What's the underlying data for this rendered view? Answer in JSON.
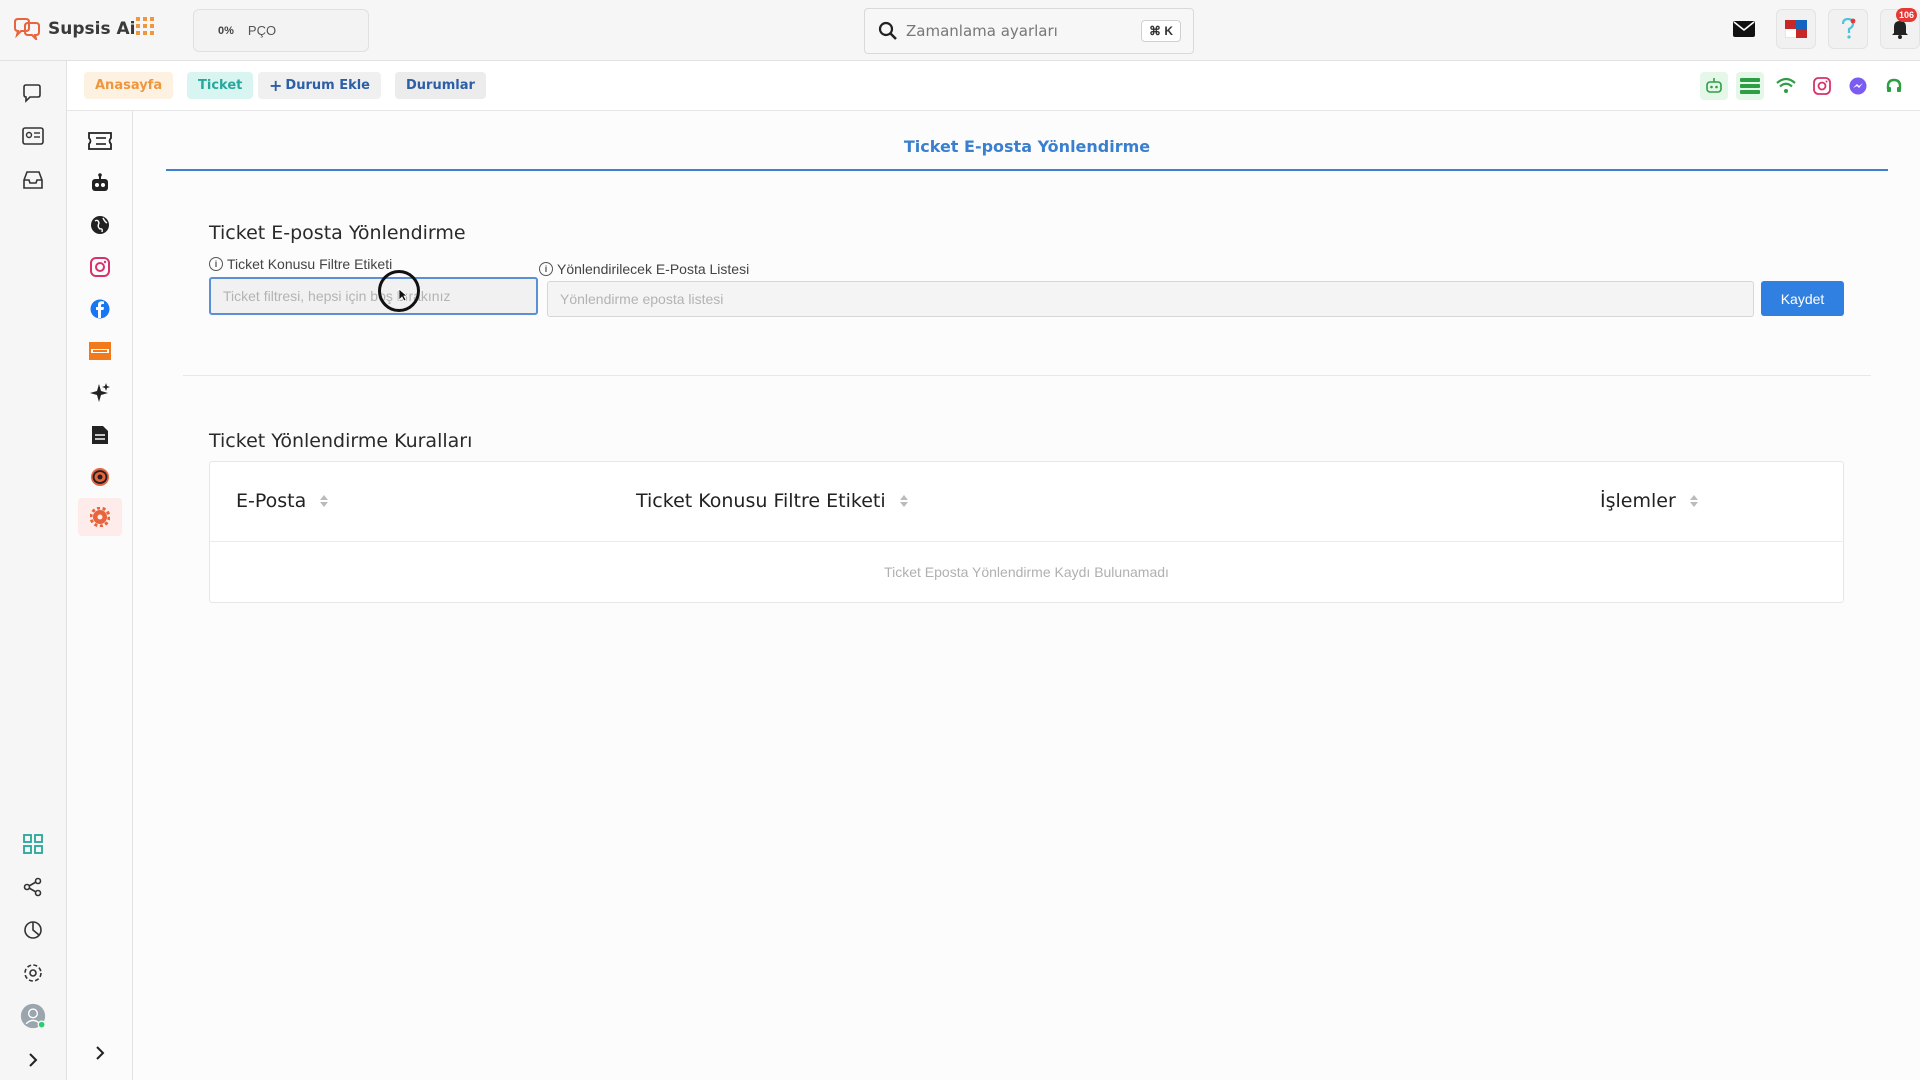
{
  "app": {
    "name": "Supsis Ai",
    "progress": {
      "percent": "0%",
      "label": "PÇO"
    },
    "search_placeholder": "Zamanlama ayarları",
    "search_shortcut": "⌘ K",
    "notification_count": "106"
  },
  "breadcrumbs": {
    "home": "Anasayfa",
    "ticket": "Ticket",
    "add_status": "Durum Ekle",
    "statuses": "Durumlar"
  },
  "page": {
    "tab_title": "Ticket E-posta Yönlendirme",
    "form_title": "Ticket E-posta Yönlendirme",
    "filter_label": "Ticket Konusu Filtre Etiketi",
    "filter_placeholder": "Ticket filtresi, hepsi için boş bırakınız",
    "email_label": "Yönlendirilecek E-Posta Listesi",
    "email_placeholder": "Yönlendirme eposta listesi",
    "save_label": "Kaydet",
    "rules_title": "Ticket Yönlendirme Kuralları",
    "columns": [
      "E-Posta",
      "Ticket Konusu Filtre Etiketi",
      "İşlemler"
    ],
    "empty_text": "Ticket Eposta Yönlendirme Kaydı Bulunamadı"
  },
  "colors": {
    "accent": "#2f80e0",
    "home_chip": "#f0963c",
    "ticket_chip": "#28a89a",
    "active_nav": "#e8643c"
  }
}
